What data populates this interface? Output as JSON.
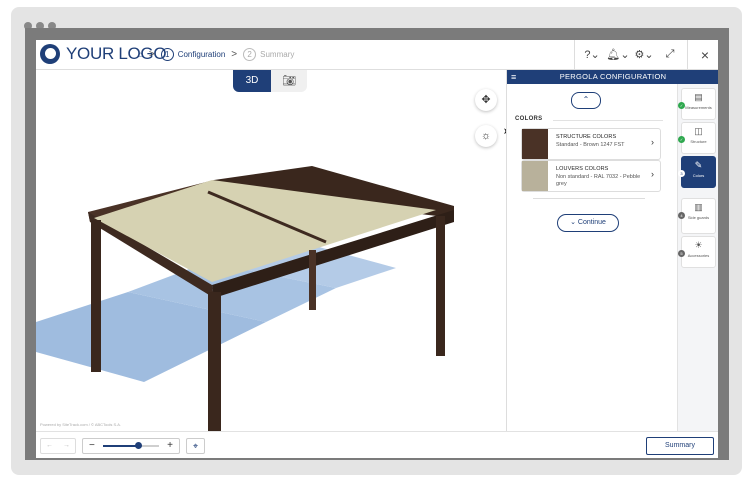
{
  "header": {
    "logo_text": "YOUR LOGO",
    "home_icon": "home-icon",
    "breadcrumb_sep": ">",
    "steps": [
      {
        "num": "1",
        "label": "Configuration"
      },
      {
        "num": "2",
        "label": "Summary"
      }
    ]
  },
  "viewer": {
    "mode_3d_label": "3D",
    "camera_icon": "camera-icon",
    "rotate_icon": "rotate-icon",
    "light_icon": "sun-icon",
    "powered_by": "Powered by SiteTrack.com / © ABCTools S.A."
  },
  "panel": {
    "title": "PERGOLA CONFIGURATION",
    "section_title": "COLORS",
    "colors": [
      {
        "label": "STRUCTURE COLORS",
        "value": "Standard - Brown 1247 FST",
        "swatch": "#4a3226"
      },
      {
        "label": "LOUVERS COLORS",
        "value": "Non standard - RAL 7032 - Pebble grey",
        "swatch": "#b8b19b"
      }
    ],
    "continue_label": "Continue"
  },
  "rail": {
    "steps": [
      {
        "label": "Measurements",
        "status": "done",
        "badge": ""
      },
      {
        "label": "Structure",
        "status": "done",
        "badge": ""
      },
      {
        "label": "Colors",
        "status": "active",
        "badge": "3"
      },
      {
        "label": "Side guards",
        "status": "pending",
        "badge": "4"
      },
      {
        "label": "Accessories",
        "status": "pending",
        "badge": "5"
      }
    ]
  },
  "footer": {
    "zoom_level": 0.62,
    "summary_label": "Summary"
  },
  "colors": {
    "brand": "#1f3f78",
    "frame_brown": "#3e2a20",
    "louver": "#d6d2b2",
    "shadow": "#9fbcdf",
    "done_green": "#2fa84f"
  }
}
